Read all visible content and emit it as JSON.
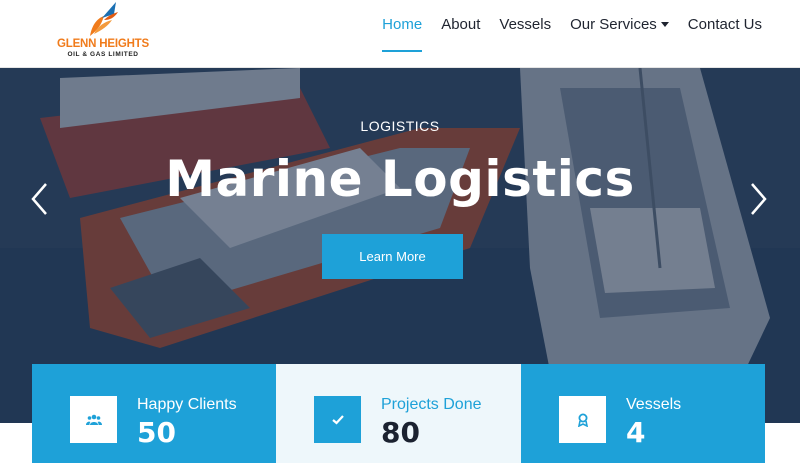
{
  "brand": {
    "name": "GLENN HEIGHTS",
    "tagline": "OIL & GAS LIMITED",
    "logo_icon": "rocket-flame-icon",
    "colors": {
      "orange": "#f07b1b",
      "accent": "#1ea1d8"
    }
  },
  "nav": {
    "items": [
      {
        "label": "Home",
        "active": true
      },
      {
        "label": "About"
      },
      {
        "label": "Vessels"
      },
      {
        "label": "Our Services",
        "dropdown": true
      },
      {
        "label": "Contact Us"
      }
    ]
  },
  "hero": {
    "kicker": "LOGISTICS",
    "title": "Marine Logistics",
    "button": "Learn More",
    "prev_icon": "chevron-left-icon",
    "next_icon": "chevron-right-icon"
  },
  "stats": [
    {
      "label": "Happy Clients",
      "value": "50",
      "icon": "users-icon"
    },
    {
      "label": "Projects Done",
      "value": "80",
      "icon": "check-icon"
    },
    {
      "label": "Vessels",
      "value": "4",
      "icon": "award-icon"
    }
  ]
}
